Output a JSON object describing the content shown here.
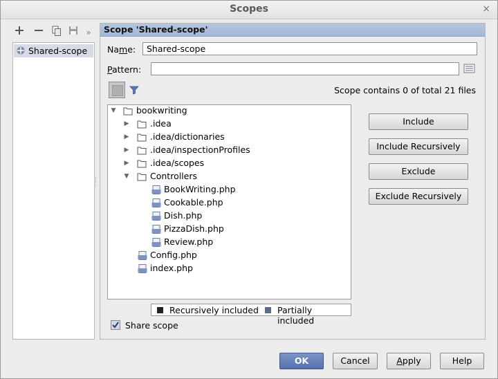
{
  "window": {
    "title": "Scopes",
    "close": "×"
  },
  "toolbar": {
    "overflow": "»"
  },
  "scopes_list": [
    {
      "label": "Shared-scope"
    }
  ],
  "panel": {
    "header": "Scope 'Shared-scope'",
    "name_label_pre": "Na",
    "name_label_u": "m",
    "name_label_post": "e:",
    "name_value": "Shared-scope",
    "pattern_label_u": "P",
    "pattern_label_post": "attern:",
    "pattern_value": "",
    "scope_info": "Scope contains 0 of total 21 files"
  },
  "tree": {
    "root": "bookwriting",
    "idea": ".idea",
    "dictionaries": ".idea/dictionaries",
    "inspection": ".idea/inspectionProfiles",
    "scopes": ".idea/scopes",
    "controllers": "Controllers",
    "f1": "BookWriting.php",
    "f2": "Cookable.php",
    "f3": "Dish.php",
    "f4": "PizzaDish.php",
    "f5": "Review.php",
    "config": "Config.php",
    "index": "index.php"
  },
  "actions": {
    "include": "Include",
    "include_recursively": "Include Recursively",
    "exclude": "Exclude",
    "exclude_recursively": "Exclude Recursively"
  },
  "legend": {
    "recursive": "Recursively included",
    "partial": "Partially included",
    "recursive_color": "#202020",
    "partial_color": "#5b6a8a"
  },
  "share": {
    "label": "Share scope",
    "checked": true
  },
  "footer": {
    "ok": "OK",
    "cancel": "Cancel",
    "apply_u": "A",
    "apply_rest": "pply",
    "help": "Help"
  },
  "colors": {
    "header": "#a9bbd9",
    "primary": "#5572ad"
  }
}
